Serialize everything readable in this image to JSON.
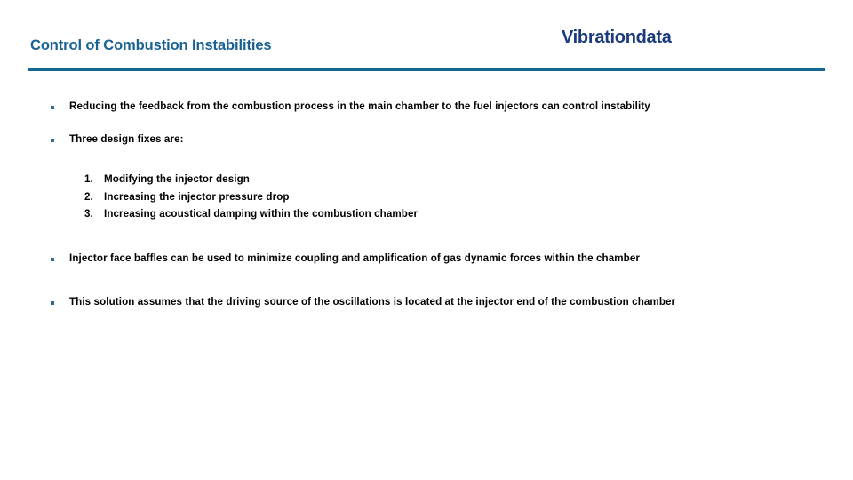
{
  "header": {
    "slide_title": "Control of Combustion Instabilities",
    "brand_logo": "Vibrationdata",
    "title_color": "#1A6292",
    "brand_color": "#1B3B7C",
    "rule_color": "#14688F"
  },
  "body": {
    "bullets": [
      {
        "text": "Reducing the feedback from the combustion process in the main chamber to the fuel injectors can control instability"
      },
      {
        "text": "Three design fixes are:"
      },
      {
        "text": "Injector face baffles can be used to minimize coupling and amplification of gas dynamic forces within the chamber"
      },
      {
        "text": "This solution assumes that the driving source of the oscillations is located at the injector end of the combustion chamber"
      }
    ],
    "numbered_list": [
      {
        "index": "1.",
        "text": "Modifying the injector design"
      },
      {
        "index": "2.",
        "text": "Increasing the injector pressure drop"
      },
      {
        "index": "3.",
        "text": "Increasing acoustical damping within the combustion chamber"
      }
    ]
  }
}
